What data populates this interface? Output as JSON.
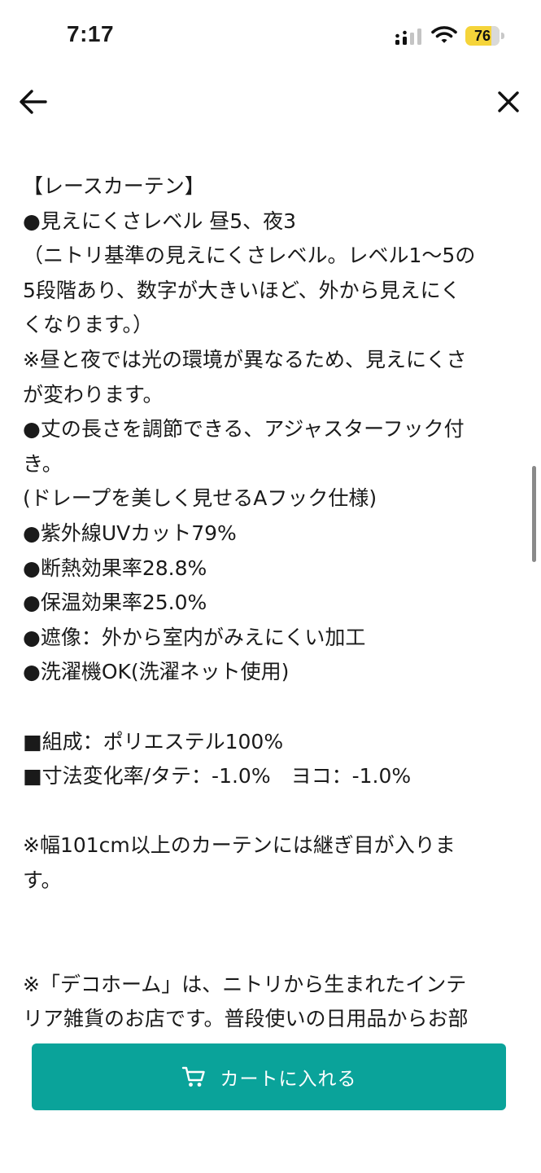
{
  "status_bar": {
    "time": "7:17",
    "battery_level": "76",
    "battery_percent": 76,
    "icons": [
      "cellular-signal-icon",
      "wifi-icon",
      "battery-icon"
    ]
  },
  "nav": {
    "back_icon": "arrow-left-icon",
    "close_icon": "close-icon"
  },
  "description": {
    "lines": [
      "【レースカーテン】",
      "●見えにくさレベル 昼5、夜3",
      "（ニトリ基準の見えにくさレベル。レベル1〜5の",
      "5段階あり、数字が大きいほど、外から見えにく",
      "くなります。）",
      "※昼と夜では光の環境が異なるため、見えにくさ",
      "が変わります。",
      "●丈の長さを調節できる、アジャスターフック付",
      "き。",
      "(ドレープを美しく見せるAフック仕様)",
      "●紫外線UVカット79%",
      "●断熱効果率28.8%",
      "●保温効果率25.0%",
      "●遮像：外から室内がみえにくい加工",
      "●洗濯機OK(洗濯ネット使用)",
      "",
      "■組成：ポリエステル100%",
      "■寸法変化率/タテ：-1.0%　ヨコ：-1.0%",
      "",
      "※幅101cm以上のカーテンには継ぎ目が入りま",
      "す。",
      "",
      "",
      "※「デコホーム」は、ニトリから生まれたインテ",
      "リア雑貨のお店です。普段使いの日用品からお部"
    ]
  },
  "cart_button": {
    "label": "カートに入れる",
    "icon": "cart-icon"
  },
  "colors": {
    "accent": "#0aa39a",
    "battery": "#f5d43a",
    "text": "#1a1a1a"
  }
}
